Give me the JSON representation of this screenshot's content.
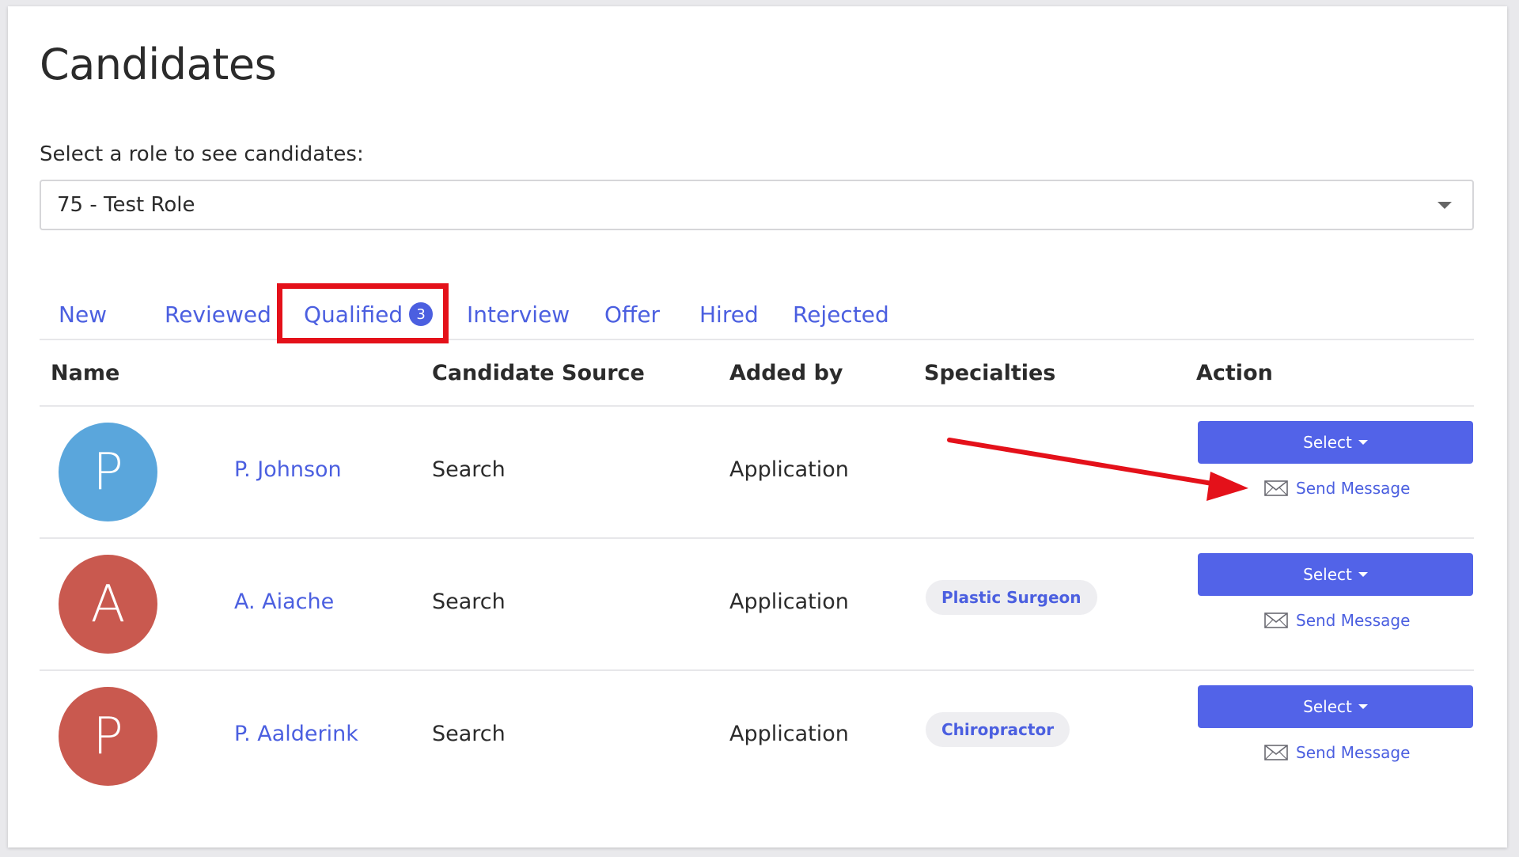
{
  "page": {
    "title": "Candidates",
    "role_prompt": "Select a role to see candidates:",
    "role_selected": "75 - Test Role"
  },
  "tabs": [
    {
      "label": "New"
    },
    {
      "label": "Reviewed"
    },
    {
      "label": "Qualified",
      "badge": "3",
      "active": true
    },
    {
      "label": "Interview"
    },
    {
      "label": "Offer"
    },
    {
      "label": "Hired"
    },
    {
      "label": "Rejected"
    }
  ],
  "table": {
    "headers": {
      "name": "Name",
      "source": "Candidate Source",
      "added_by": "Added by",
      "specialties": "Specialties",
      "action": "Action"
    },
    "rows": [
      {
        "initial": "P",
        "avatar_color": "#5aa6dc",
        "name": "P. Johnson",
        "source": "Search",
        "added_by": "Application",
        "specialty": "",
        "select_label": "Select",
        "message_label": "Send Message"
      },
      {
        "initial": "A",
        "avatar_color": "#c9594f",
        "name": "A. Aiache",
        "source": "Search",
        "added_by": "Application",
        "specialty": "Plastic Surgeon",
        "select_label": "Select",
        "message_label": "Send Message"
      },
      {
        "initial": "P",
        "avatar_color": "#c9594f",
        "name": "P. Aalderink",
        "source": "Search",
        "added_by": "Application",
        "specialty": "Chiropractor",
        "select_label": "Select",
        "message_label": "Send Message"
      }
    ]
  },
  "colors": {
    "accent": "#4b5fe0",
    "button": "#5263e8",
    "annotation": "#e4111a"
  }
}
